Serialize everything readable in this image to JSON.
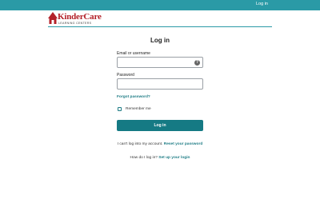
{
  "topbar": {
    "login_link": "Log in"
  },
  "logo": {
    "brand": "KinderCare",
    "sub": "LEARNING CENTERS",
    "accent_color": "#b3222a"
  },
  "form": {
    "title": "Log in",
    "username_label": "Email or username",
    "username_value": "",
    "password_label": "Password",
    "password_value": "",
    "forgot_link": "Forgot password?",
    "remember_label": "Remember me",
    "remember_checked": false,
    "submit_label": "Log in"
  },
  "help": {
    "cant_login_text": "I can't log into my account.",
    "reset_link": "Reset your password",
    "how_text": "How do I log in?",
    "setup_link": "Set up your login"
  },
  "colors": {
    "topbar": "#2a9aa6",
    "button": "#157a84",
    "link": "#1e7c85"
  }
}
